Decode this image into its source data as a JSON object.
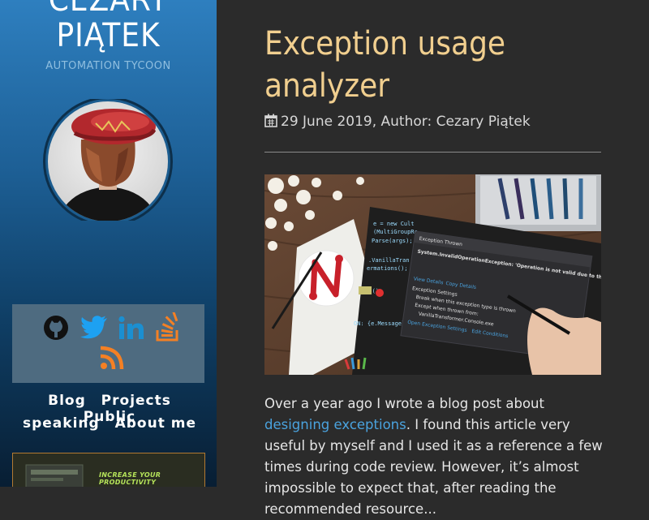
{
  "sidebar": {
    "name_line1": "CEZARY",
    "name_line2": "PIĄTEK",
    "tagline": "AUTOMATION TYCOON",
    "social_icons": [
      "github-icon",
      "twitter-icon",
      "linkedin-icon",
      "stackoverflow-icon",
      "rss-icon"
    ],
    "nav": {
      "blog": "Blog",
      "projects": "Projects",
      "public": "Public",
      "speaking": "speaking",
      "about": "About me"
    },
    "promo_text": "INCREASE YOUR PRODUCTIVITY"
  },
  "post": {
    "title_line1": "Exception usage",
    "title_line2": "analyzer",
    "meta": "29 June 2019, Author: Cezary Piątek",
    "hero": {
      "code_lines": [
        "e = new Cult",
        "(MultiGroupRe",
        "Parse(args);",
        ".VanillaTran",
        "ermations();",
        "ion();",
        "ON: {e.Message}\");"
      ],
      "dialog_title": "Exception Thrown",
      "dialog_message": "System.InvalidOperationException: 'Operation is not valid due to the current state of the object.'",
      "view_details": "View Details",
      "copy_details": "Copy Details",
      "settings_header": "Exception Settings",
      "break_when": "Break when this exception type is thrown",
      "except_when": "Except when thrown from:",
      "except_module": "VanillaTransformer.Console.exe",
      "open_settings": "Open Exception Settings",
      "edit_conditions": "Edit Conditions"
    },
    "paragraph": {
      "part1": "Over a year ago I wrote a blog post about ",
      "link": "designing exceptions",
      "part2": ". I found this article very useful by myself and I used it as a reference a few times during code review. However, it’s almost impossible to expect that, after reading the recommended resource..."
    }
  },
  "colors": {
    "title": "#f1cf8f",
    "link": "#4aa3df",
    "main_bg": "#2b2b2b",
    "social_orange": "#f48024",
    "social_blue": "#1da1f2"
  }
}
